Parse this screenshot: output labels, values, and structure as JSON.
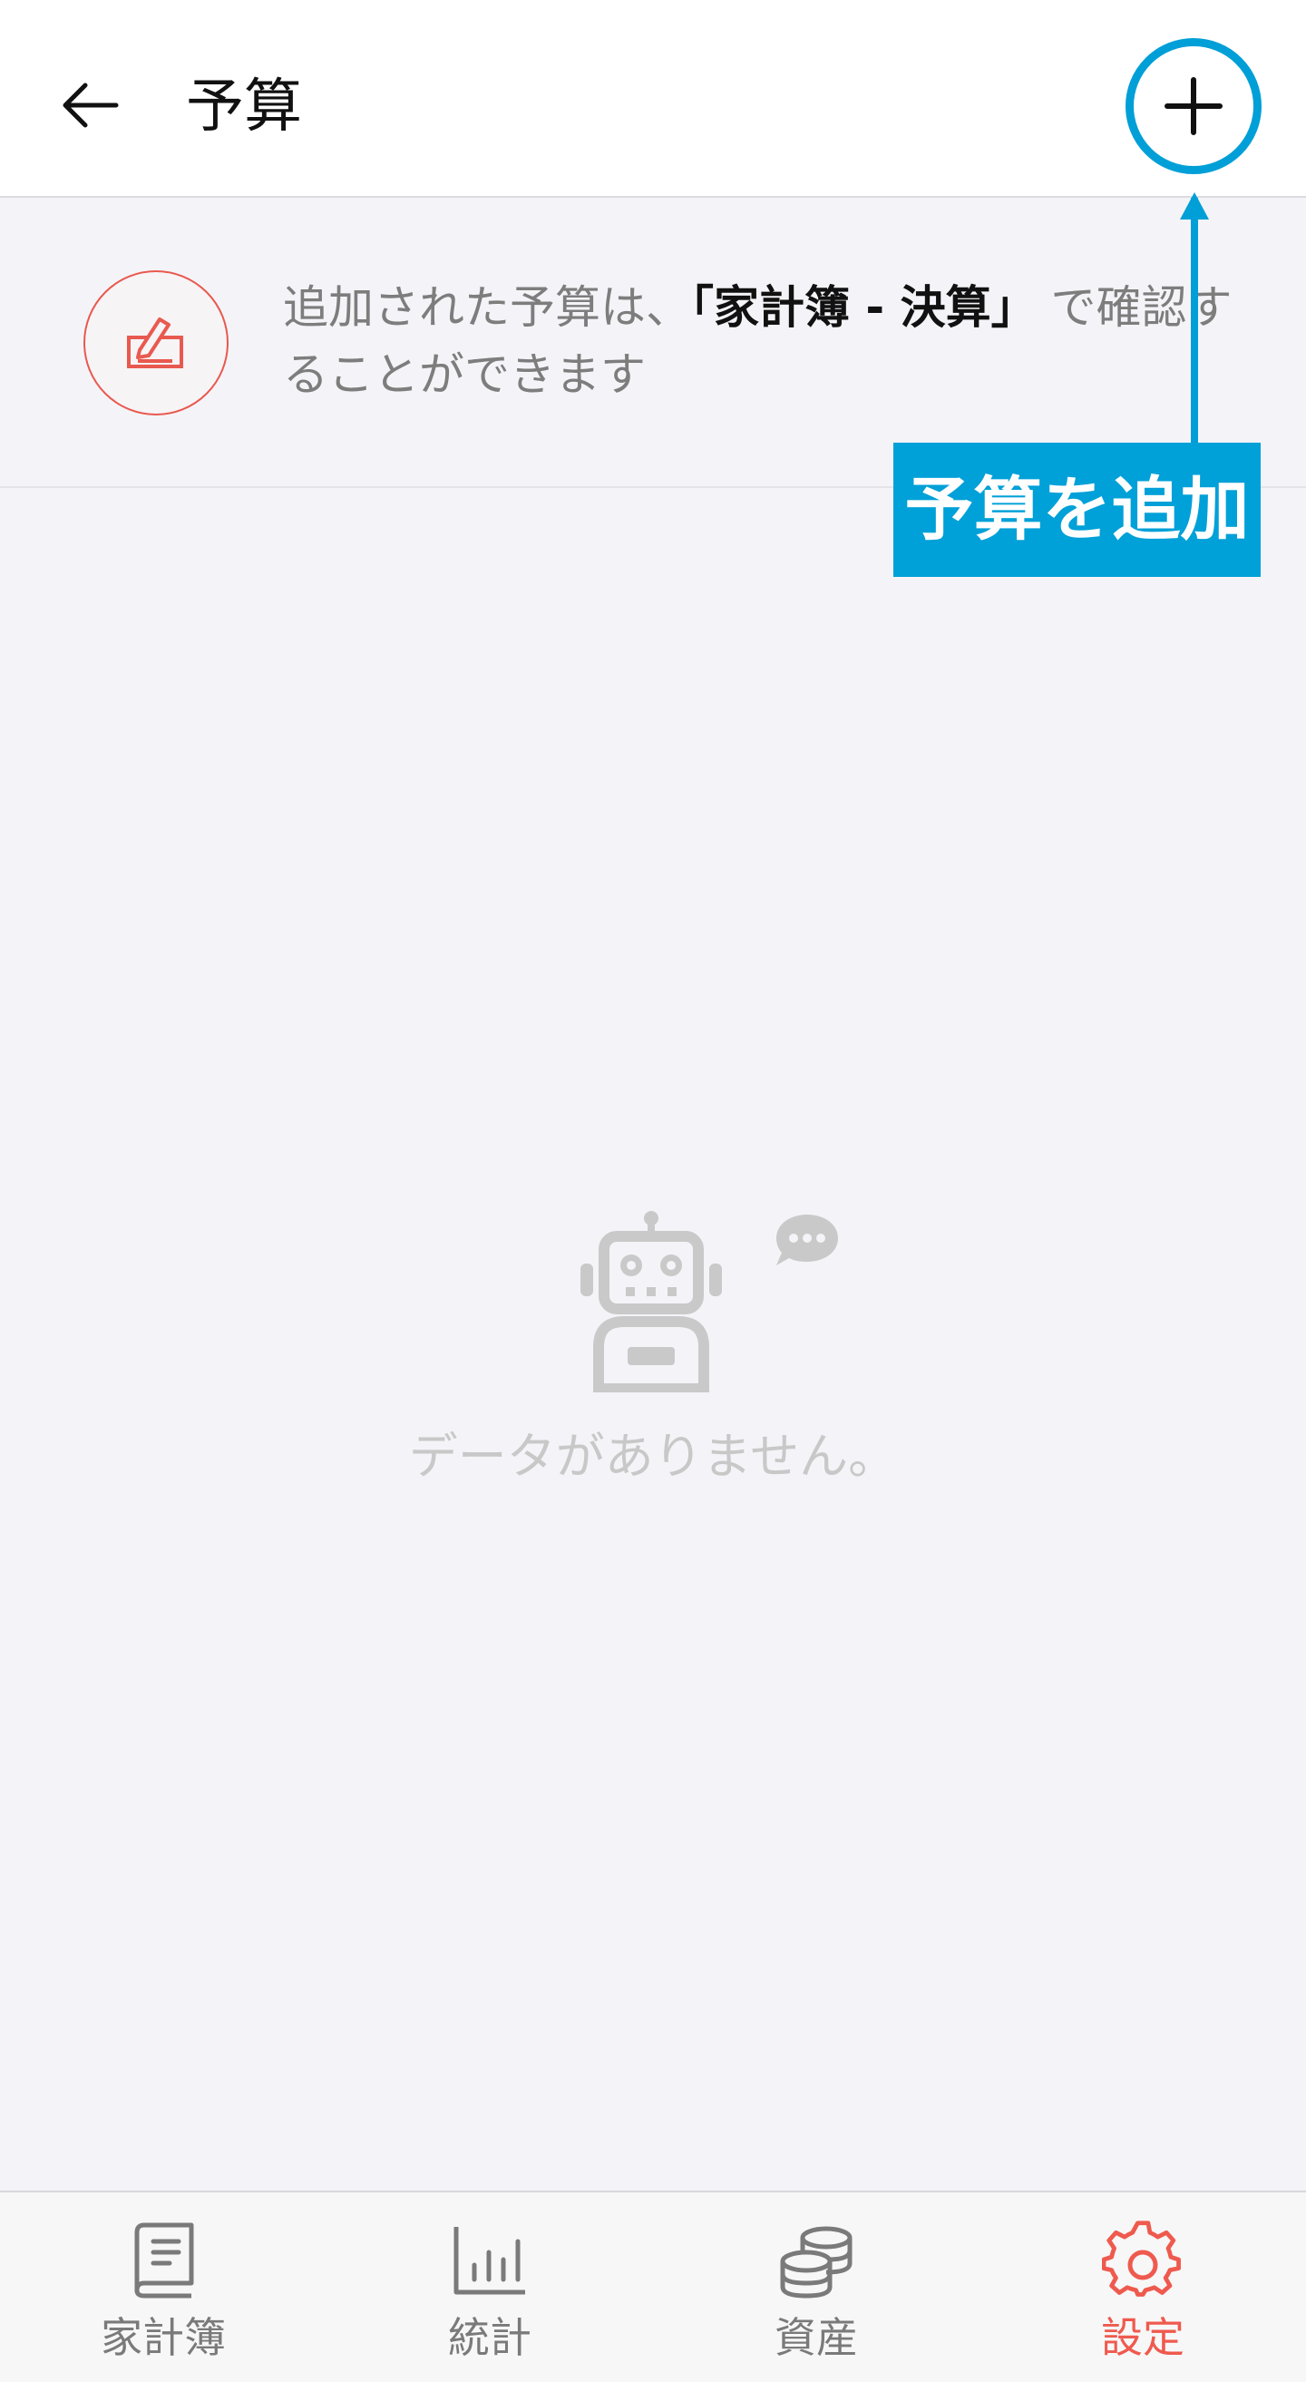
{
  "header": {
    "title": "予算",
    "back_icon": "arrow-left-icon",
    "add_icon": "plus-icon"
  },
  "info": {
    "text_before": "追加された予算は、",
    "text_bold": "「家計簿 - 決算」",
    "text_after": " で確認することができます",
    "icon": "edit-note-icon"
  },
  "annotation": {
    "label": "予算を追加",
    "color": "#00a0d8"
  },
  "empty_state": {
    "icon": "robot-chat-icon",
    "message": "データがありません。"
  },
  "bottom_nav": {
    "items": [
      {
        "label": "家計簿",
        "icon": "book-icon",
        "active": false
      },
      {
        "label": "統計",
        "icon": "chart-icon",
        "active": false
      },
      {
        "label": "資産",
        "icon": "coins-icon",
        "active": false
      },
      {
        "label": "設定",
        "icon": "gear-icon",
        "active": true
      }
    ]
  },
  "colors": {
    "accent": "#ef5a4e",
    "highlight": "#009fd7",
    "background": "#f4f4f8"
  }
}
